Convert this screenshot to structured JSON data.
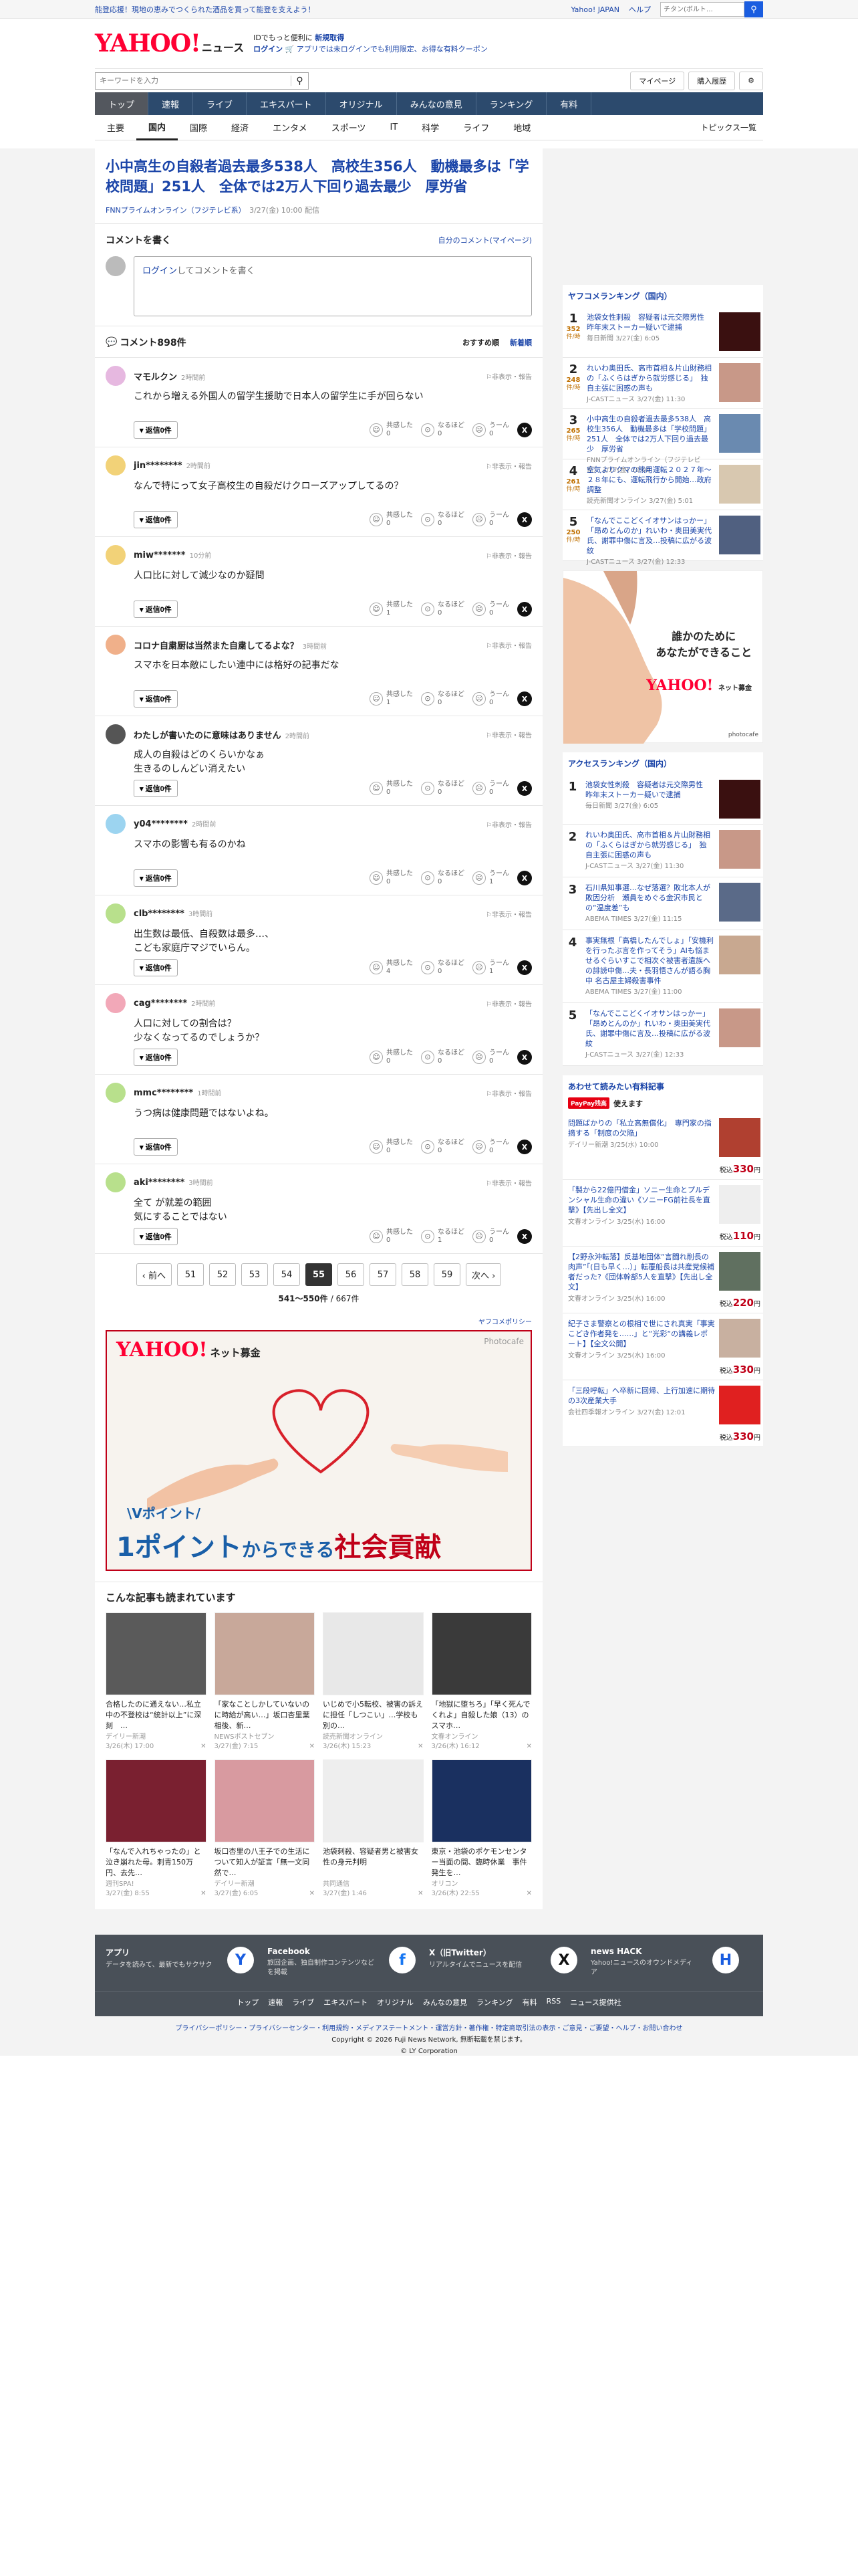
{
  "topbar": {
    "promo": "能登応援！現地の恵みでつくられた酒品を買って能登を支えよう！",
    "yahoo_japan": "Yahoo! JAPAN",
    "help": "ヘルプ",
    "search_ph": "ウェブ検索",
    "search_val": "チタン(ボルト…"
  },
  "header": {
    "logo": "YAHOO!",
    "logo_news": "ニュース",
    "msg1": "IDでもっと便利に",
    "msg1b": "新規取得",
    "login": "ログイン",
    "msg2": "アプリでは未ログインでも利用限定、お得な有料クーポン"
  },
  "search": {
    "placeholder": "キーワードを入力",
    "mypage": "マイページ",
    "buy": "購入履歴"
  },
  "gnav": [
    "トップ",
    "速報",
    "ライブ",
    "エキスパート",
    "オリジナル",
    "みんなの意見",
    "ランキング",
    "有料"
  ],
  "subnav": {
    "items": [
      "主要",
      "国内",
      "国際",
      "経済",
      "エンタメ",
      "スポーツ",
      "IT",
      "科学",
      "ライフ",
      "地域"
    ],
    "topics": "トピックス一覧"
  },
  "article": {
    "title": "小中高生の自殺者過去最多538人　高校生356人　動機最多は「学校問題」251人　全体では2万人下回り過去最少　厚労省",
    "source": "FNNプライムオンライン（フジテレビ系）",
    "date": "3/27(金) 10:00 配信"
  },
  "comment_write": {
    "title": "コメントを書く",
    "mine": "自分のコメント(マイページ)",
    "login": "ログイン",
    "prompt": "してコメントを書く"
  },
  "comments_head": {
    "title": "コメント898件",
    "sort1": "おすすめ順",
    "sort2": "新着順"
  },
  "labels": {
    "reply": "▾ 返信0件",
    "hide": "非表示・報告",
    "r1": "共感した",
    "r2": "なるほど",
    "r3": "うーん"
  },
  "comments": [
    {
      "user": "マモルクン",
      "time": "2時間前",
      "text": "これから増える外国人の留学生援助で日本人の留学生に手が回らない",
      "c": [
        "0",
        "0",
        "0"
      ],
      "color": "#e6b8e0"
    },
    {
      "user": "jin********",
      "time": "2時間前",
      "text": "なんで特にって女子高校生の自殺だけクローズアップしてるの？",
      "c": [
        "0",
        "0",
        "0"
      ],
      "color": "#f2d278"
    },
    {
      "user": "miw*******",
      "time": "10分前",
      "text": "人口比に対して減少なのか疑問",
      "c": [
        "1",
        "0",
        "0"
      ],
      "color": "#f2d278"
    },
    {
      "user": "コロナ自粛厨は当然また自粛してるよな？",
      "time": "3時間前",
      "text": "スマホを日本敵にしたい連中には格好の記事だな",
      "c": [
        "1",
        "0",
        "0"
      ],
      "color": "#f0b08a"
    },
    {
      "user": "わたしが書いたのに意味はありません",
      "time": "2時間前",
      "text": "成人の自殺はどのくらいかなぁ\n生きるのしんどい消えたい",
      "c": [
        "0",
        "0",
        "0"
      ],
      "color": "#555"
    },
    {
      "user": "y04********",
      "time": "2時間前",
      "text": "スマホの影響も有るのかね",
      "c": [
        "0",
        "0",
        "1"
      ],
      "color": "#9cd4f0"
    },
    {
      "user": "clb********",
      "time": "3時間前",
      "text": "出生数は最低、自殺数は最多…、\nこども家庭庁マジでいらん。",
      "c": [
        "4",
        "0",
        "1"
      ],
      "color": "#b8e08c"
    },
    {
      "user": "cag********",
      "time": "2時間前",
      "text": "人口に対しての割合は？\n少なくなってるのでしょうか？",
      "c": [
        "0",
        "0",
        "0"
      ],
      "color": "#f2a8b8"
    },
    {
      "user": "mmc********",
      "time": "1時間前",
      "text": "うつ病は健康問題ではないよね。",
      "c": [
        "0",
        "0",
        "0"
      ],
      "color": "#b8e08c"
    },
    {
      "user": "aki********",
      "time": "3時間前",
      "text": "全て が就差の範囲\n気にすることではない",
      "c": [
        "0",
        "1",
        "0"
      ],
      "color": "#b8e08c"
    }
  ],
  "pager": {
    "prev": "‹ 前へ",
    "next": "次へ ›",
    "pages": [
      "51",
      "52",
      "53",
      "54",
      "55",
      "56",
      "57",
      "58",
      "59"
    ],
    "range": "541〜550件",
    "total": "/ 667件"
  },
  "policy": "ヤフコメポリシー",
  "ad1": {
    "logo": "YAHOO!",
    "logo2": "ネット募金",
    "photo": "Photocafe",
    "sub": "\\Vポイント/",
    "m1": "1ポイント",
    "m2": "からできる",
    "m3": "社会貢献"
  },
  "related": {
    "title": "こんな記事も読まれています",
    "items": [
      {
        "t": "合格したのに通えない…私立中の不登校は“統計以上”に深刻　…",
        "s": "デイリー新潮",
        "d": "3/26(木) 17:00"
      },
      {
        "t": "「家なことしかしていないのに時給が高い…」坂口杏里葉相後、新…",
        "s": "NEWSポストセブン",
        "d": "3/27(金) 7:15"
      },
      {
        "t": "いじめで小5転校、被害の訴えに担任「しつこい」…学校も別の…",
        "s": "読売新聞オンライン",
        "d": "3/26(木) 15:23"
      },
      {
        "t": "「地獄に堕ちろ」「早く死んでくれよ」自殺した娘（13）のスマホ…",
        "s": "文春オンライン",
        "d": "3/26(木) 16:12"
      },
      {
        "t": "「なんで入れちゃったの」と泣き崩れた母。刺青150万円、去先…",
        "s": "週刊SPA!",
        "d": "3/27(金) 8:55"
      },
      {
        "t": "坂口杏里の八王子での生活について知人が証言「無一文同然で…",
        "s": "デイリー新潮",
        "d": "3/27(金) 6:05"
      },
      {
        "t": "池袋刺殺、容疑者男と被害女性の身元判明",
        "s": "共同通信",
        "d": "3/27(金) 1:46"
      },
      {
        "t": "東京・池袋のポケモンセンター当面の間、臨時休業　事件発生を…",
        "s": "オリコン",
        "d": "3/26(木) 22:55"
      }
    ]
  },
  "yafuco_rank": {
    "title": "ヤフコメランキング（国内）",
    "unit": "件/時",
    "items": [
      {
        "n": "1",
        "v": "352",
        "t": "池袋女性刺殺　容疑者は元交際男性　昨年末ストーカー疑いで逮捕",
        "s": "毎日新聞 3/27(金) 6:05"
      },
      {
        "n": "2",
        "v": "248",
        "t": "れいわ奥田氏、高市首相＆片山財務相の「ふくらはぎから就労感じる」　独自主張に困惑の声も",
        "s": "J-CASTニュース 3/27(金) 11:30"
      },
      {
        "n": "3",
        "v": "265",
        "t": "小中高生の自殺者過去最多538人　高校生356人　動機最多は「学校問題」251人　全体では2万人下回り過去最少　厚労省",
        "s": "FNNプライムオンライン（フジテレビ系） 3/27(金) 10:00"
      },
      {
        "n": "4",
        "v": "261",
        "t": "空気よりクマの熊用運転２０２７年～２８年にも、運転飛行から開始…政府調整",
        "s": "読売新聞オンライン 3/27(金) 5:01"
      },
      {
        "n": "5",
        "v": "250",
        "t": "「なんでここどくイオサンはっかー」「昂めとんのか」れいわ・奥田美実代氏、謝罪中傷に言及…投稿に広がる波紋",
        "s": "J-CASTニュース 3/27(金) 12:33"
      }
    ]
  },
  "ad2": {
    "l1": "誰かのために",
    "l2": "あなたができること",
    "logo": "YAHOO!",
    "logo2": "ネット募金",
    "photo": "photocafe"
  },
  "access_rank": {
    "title": "アクセスランキング（国内）",
    "items": [
      {
        "n": "1",
        "t": "池袋女性刺殺　容疑者は元交際男性　昨年末ストーカー疑いで逮捕",
        "s": "毎日新聞 3/27(金) 6:05"
      },
      {
        "n": "2",
        "t": "れいわ奥田氏、高市首相＆片山財務相の「ふくらはぎから就労感じる」　独自主張に困惑の声も",
        "s": "J-CASTニュース 3/27(金) 11:30"
      },
      {
        "n": "3",
        "t": "石川県知事選…なぜ落選？敗北本人が敗因分析　瀬員をめぐる金沢市民との“温度差”も",
        "s": "ABEMA TIMES 3/27(金) 11:15"
      },
      {
        "n": "4",
        "t": "事実無根「高橋したんでしょ」「安機利を行ったぶ言を作ってそう」AIも悩ませるぐらいすこで相次ぐ被害者遺族への誹謗中傷…夫・長羽悟さんが語る胸中 名古屋主婦殺害事件",
        "s": "ABEMA TIMES 3/27(金) 11:00"
      },
      {
        "n": "5",
        "t": "「なんでここどくイオサンはっかー」「昂めとんのか」れいわ・奥田美実代氏、謝罪中傷に言及…投稿に広がる波紋",
        "s": "J-CASTニュース 3/27(金) 12:33"
      }
    ]
  },
  "paid": {
    "title": "あわせて読みたい有料記事",
    "pp": "PayPay残高",
    "pp2": "使えます",
    "unit": "税込",
    "items": [
      {
        "t": "問題ばかりの「私立高無償化」　専門家の指摘する「制度の欠陥」",
        "s": "デイリー新潮 3/25(水) 10:00",
        "p": "330",
        "y": "円"
      },
      {
        "t": "「製から22億円借金」ソニー生命とプルデンシャル生命の違い《ソニーFG前社長を直撃》【先出し全文】",
        "s": "文春オンライン 3/25(水) 16:00",
        "p": "110",
        "y": "円"
      },
      {
        "t": "【2野永沖転落】反基地団体“言闘れ削長の肉声”「(日も早く…）」転覆船長は共産党候補者だった?《団体幹部5人を直撃》【先出し全文】",
        "s": "文春オンライン 3/25(水) 16:00",
        "p": "220",
        "y": "円"
      },
      {
        "t": "紀子さま警察との根相で世にされ真実「事実こどき作者発を……」と“光彩“の講義レポート】【全文公開】",
        "s": "文春オンライン 3/25(水) 16:00",
        "p": "330",
        "y": "円"
      },
      {
        "t": "「三段呼転」へ卒新に回帰、上行加速に期待の3次産業大手",
        "s": "会社四季報オンライン 3/27(金) 12:01",
        "p": "330",
        "y": "円"
      }
    ]
  },
  "footer": {
    "apps": [
      {
        "t": "アプリ",
        "d": "データを読みて、最新でもサクサク",
        "i": "Y"
      },
      {
        "t": "Facebook",
        "d": "旅回企画、独自制作コンテンツなどを掲載",
        "i": "f"
      },
      {
        "t": "X（旧Twitter）",
        "d": "リアルタイムでニュースを配信",
        "i": "X"
      },
      {
        "t": "news HACK",
        "d": "Yahoo!ニュースのオウンドメディア",
        "i": "H"
      }
    ],
    "nav": [
      "トップ",
      "速報",
      "ライブ",
      "エキスパート",
      "オリジナル",
      "みんなの意見",
      "ランキング",
      "有料",
      "RSS",
      "ニュース提供社"
    ]
  },
  "copy": {
    "links": "プライバシーポリシー・プライバシーセンター・利用規約・メディアステートメント・運営方針・著作権・特定商取引法の表示・ご意見・ご要望・ヘルプ・お問い合わせ",
    "c1": "Copyright © 2026 Fuji News Network, 無断転載を禁じます。",
    "c2": "© LY Corporation"
  },
  "colors": {
    "brand": "#ff0033",
    "link": "#1a44a8",
    "nav": "#2c4a6d"
  }
}
